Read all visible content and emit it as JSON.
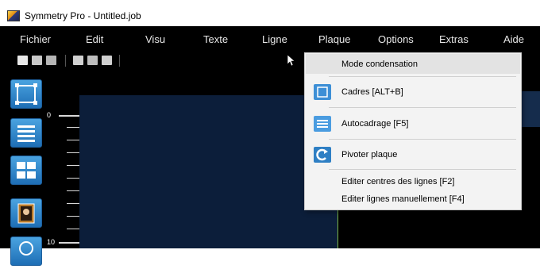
{
  "window": {
    "title": "Symmetry Pro  -  Untitled.job",
    "app_icon": "symmetry-app-icon"
  },
  "menubar": {
    "items": [
      {
        "label": "Fichier"
      },
      {
        "label": "Edit"
      },
      {
        "label": "Visu"
      },
      {
        "label": "Texte"
      },
      {
        "label": "Ligne"
      },
      {
        "label": "Plaque"
      },
      {
        "label": "Options"
      },
      {
        "label": "Extras"
      },
      {
        "label": "Aide"
      }
    ]
  },
  "toolbar": {
    "icons": [
      "new-file-icon",
      "open-folder-icon",
      "save-icon",
      "print-icon",
      "copy-icon",
      "paste-icon"
    ]
  },
  "left_tools": [
    {
      "icon": "frame-icon"
    },
    {
      "icon": "lines-icon"
    },
    {
      "icon": "grid-icon"
    },
    {
      "icon": "portrait-icon"
    },
    {
      "icon": "zoom-icon"
    }
  ],
  "ruler": {
    "labels": [
      "0",
      "10"
    ]
  },
  "plaque_menu": {
    "items": [
      {
        "label": "Mode condensation",
        "icon": null,
        "highlighted": true
      },
      {
        "label": "Cadres [ALT+B]",
        "icon": "frame-icon"
      },
      {
        "label": "Autocadrage [F5]",
        "icon": "lines-icon"
      },
      {
        "label": "Pivoter plaque",
        "icon": "rotate-icon"
      },
      {
        "label": "Editer centres des lignes [F2]",
        "icon": null
      },
      {
        "label": "Editer lignes manuellement [F4]",
        "icon": null
      }
    ]
  },
  "colors": {
    "menubar_bg": "#000000",
    "plate_bg": "#0c1e3a",
    "tool_button": "#2a7fc7",
    "menu_bg": "#f3f3f3"
  }
}
